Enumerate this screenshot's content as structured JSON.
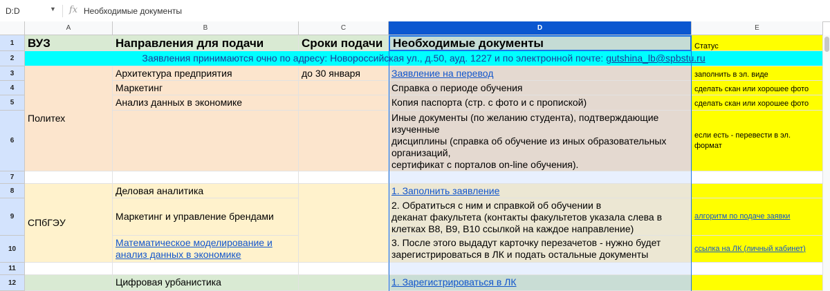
{
  "formula_bar": {
    "name_box": "D:D",
    "fx": "fx",
    "value": "Необходимые документы"
  },
  "columns": [
    "A",
    "B",
    "C",
    "D",
    "E"
  ],
  "rows": [
    "1",
    "2",
    "3",
    "4",
    "5",
    "6",
    "7",
    "8",
    "9",
    "10",
    "11",
    "12"
  ],
  "cells": {
    "A1": "ВУЗ",
    "B1": "Направления для подачи",
    "C1": "Сроки подачи",
    "D1": "Необходимые документы",
    "E1": "Статус",
    "row2_text": "Заявления принимаются очно по адресу: Новороссийская ул., д.50, ауд. 1227 и по электронной почте: ",
    "row2_email": "gutshina_lb@spbstu.ru",
    "A4": "Политех",
    "B3": "Архитектура предприятия",
    "C3": "до 30 января",
    "D3": "Заявление на перевод",
    "E3": "заполнить в эл. виде",
    "B4": "Маркетинг",
    "D4": "Справка о периоде обучения",
    "E4": "сделать скан или хорошее фото",
    "B5": "Анализ данных в экономике",
    "D5": "Копия паспорта (стр. с фото и с пропиской)",
    "E5": "сделать скан или хорошее фото",
    "D6": "Иные документы (по желанию студента), подтверждающие\nизученные\nдисциплины (справка об обучение из иных образовательных\nорганизаций,\nсертификат с порталов on-line обучения).",
    "E6": "если есть - перевести в эл. формат",
    "B8": "Деловая аналитика",
    "D8": "1. Заполнить заявление",
    "A9": "СПбГЭУ",
    "B9": "Маркетинг и управление брендами",
    "D9": "2. Обратиться с ним и справкой об обучении в\nдеканат факультета (контакты факультетов указала слева в\nклетках B8, B9, B10 ссылкой на каждое направление)",
    "E9": "алгоритм по подаче заявки",
    "B10": "Математическое моделирование и анализ данных в экономике",
    "D10": "3. После этого выдадут карточку перезачетов - нужно будет\nзарегистрироваться в ЛК и подать остальные документы",
    "E10": "ссылка на ЛК (личный кабинет)",
    "B12": "Цифровая урбанистика",
    "D12": "1. Зарегистрироваться в ЛК"
  }
}
